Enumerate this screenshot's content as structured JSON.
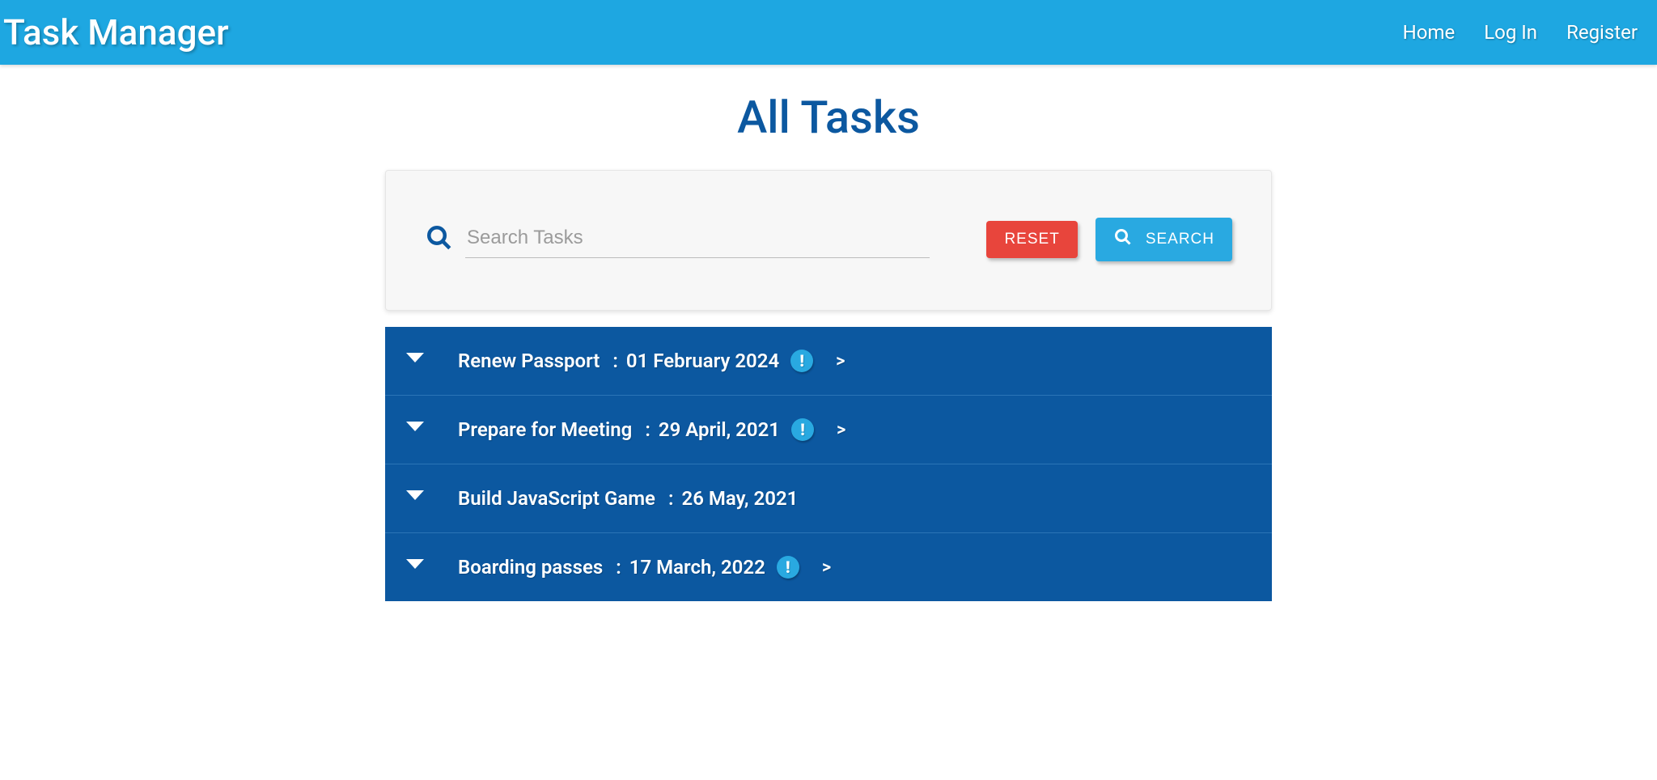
{
  "header": {
    "app_title": "Task Manager",
    "nav": {
      "home": "Home",
      "login": "Log In",
      "register": "Register"
    }
  },
  "main": {
    "page_title": "All Tasks",
    "search": {
      "placeholder": "Search Tasks",
      "value": "",
      "reset_label": "RESET",
      "search_label": "SEARCH"
    },
    "tasks": [
      {
        "title": "Renew Passport",
        "date": "01 February 2024",
        "alert": true,
        "arrow": ">"
      },
      {
        "title": "Prepare for Meeting",
        "date": "29 April, 2021",
        "alert": true,
        "arrow": ">"
      },
      {
        "title": "Build JavaScript Game",
        "date": "26 May, 2021",
        "alert": false,
        "arrow": ""
      },
      {
        "title": "Boarding passes",
        "date": "17 March, 2022",
        "alert": true,
        "arrow": ">"
      }
    ],
    "separator": ":"
  }
}
